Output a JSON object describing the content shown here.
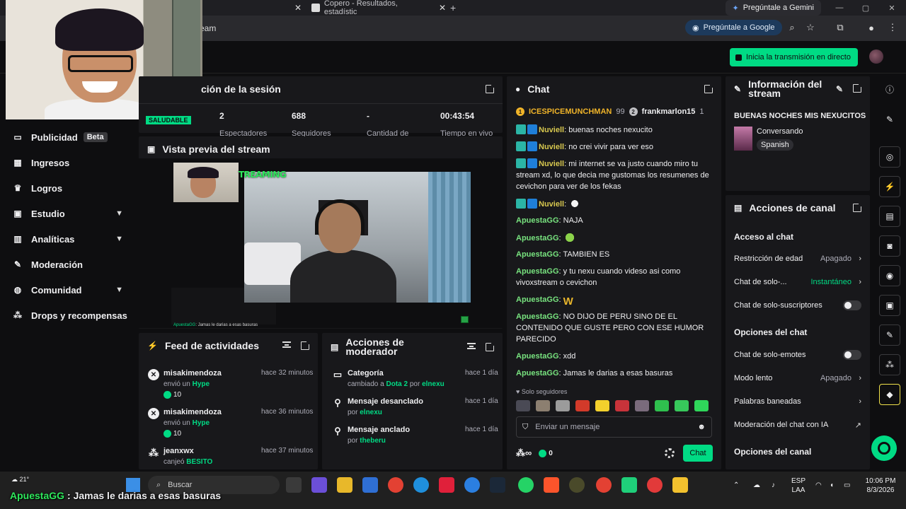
{
  "browser": {
    "tab_active_title": "Copero - Resultados, estadístic",
    "address_fragment": "eam",
    "gemini_label": "Pregúntale a Gemini",
    "ask_google_label": "Pregúntale a Google"
  },
  "appbar": {
    "go_live_label": "Inicia la transmisión en directo"
  },
  "sidebar": {
    "items": [
      {
        "label": "Publicidad",
        "badge": "Beta",
        "icon": "ad-icon"
      },
      {
        "label": "Ingresos",
        "icon": "revenue-icon"
      },
      {
        "label": "Logros",
        "icon": "trophy-icon"
      },
      {
        "label": "Estudio",
        "icon": "studio-icon",
        "expandable": true
      },
      {
        "label": "Analíticas",
        "icon": "analytics-icon",
        "expandable": true
      },
      {
        "label": "Moderación",
        "icon": "wrench-icon"
      },
      {
        "label": "Comunidad",
        "icon": "community-icon",
        "expandable": true
      },
      {
        "label": "Drops y recompensas",
        "icon": "drops-icon"
      }
    ]
  },
  "session": {
    "title": "ción de la sesión",
    "health_badge": "SALUDABLE",
    "stats": [
      {
        "value": "2",
        "label": "Espectadores"
      },
      {
        "value": "688",
        "label": "Seguidores"
      },
      {
        "value": "-",
        "label": "Cantidad de"
      },
      {
        "value": "00:43:54",
        "label": "Tiempo en vivo"
      }
    ]
  },
  "preview": {
    "title": "Vista previa del stream",
    "overlay_text": "TREAMING",
    "overlay_chat_user": "ApuestaGG",
    "overlay_chat_text": ": Jamas le darias a esas basuras"
  },
  "activity_feed": {
    "title": "Feed de actividades",
    "items": [
      {
        "user": "misakimendoza",
        "action": "envió un",
        "item": "Hype",
        "amount": "10",
        "time": "hace 32 minutos"
      },
      {
        "user": "misakimendoza",
        "action": "envió un",
        "item": "Hype",
        "amount": "10",
        "time": "hace 36 minutos"
      },
      {
        "user": "jeanxwx",
        "action": "canjeó",
        "item": "BESITO",
        "time": "hace 37 minutos"
      }
    ]
  },
  "mod_actions": {
    "title_line1": "Acciones de",
    "title_line2": "moderador",
    "items": [
      {
        "title": "Categoría",
        "sub_prefix": "cambiado a",
        "sub_hl": "Dota 2",
        "sub_mid": "por",
        "sub_user": "elnexu",
        "time": "hace 1 día"
      },
      {
        "title": "Mensaje desanclado",
        "sub_mid": "por",
        "sub_user": "elnexu",
        "time": "hace 1 día"
      },
      {
        "title": "Mensaje anclado",
        "sub_mid": "por",
        "sub_user": "theberu",
        "time": "hace 1 día"
      }
    ]
  },
  "chat": {
    "title": "Chat",
    "top_gifters": [
      {
        "rank": "1",
        "name": "ICESPICEMUNCHMAN",
        "count": "99"
      },
      {
        "rank": "2",
        "name": "frankmarlon15",
        "count": "1"
      }
    ],
    "messages": [
      {
        "user": "Nuviell",
        "text": "buenas noches nexucito"
      },
      {
        "user": "Nuviell",
        "text": "no crei vivir para ver eso"
      },
      {
        "user": "Nuviell",
        "text": "mi internet se va justo cuando miro tu stream xd, lo que decia me gustomas los resumenes de cevichon para ver de los fekas"
      },
      {
        "user": "Nuviell",
        "text": ""
      },
      {
        "user": "ApuestaGG",
        "text": "NAJA"
      },
      {
        "user": "ApuestaGG",
        "text": ""
      },
      {
        "user": "ApuestaGG",
        "text": "TAMBIEN ES"
      },
      {
        "user": "ApuestaGG",
        "text": "y tu nexu cuando videso asi como vivoxstream o cevichon"
      },
      {
        "user": "ApuestaGG",
        "text": ""
      },
      {
        "user": "ApuestaGG",
        "text": "NO DIJO DE PERU SINO DE EL CONTENIDO QUE GUSTE PERO CON ESE HUMOR PARECIDO"
      },
      {
        "user": "ApuestaGG",
        "text": "xdd"
      },
      {
        "user": "ApuestaGG",
        "text": "Jamas le darias a esas basuras"
      }
    ],
    "filter_label": "Solo seguidores",
    "input_placeholder": "Enviar un mensaje",
    "points": "0",
    "send_label": "Chat"
  },
  "stream_info": {
    "title_line1": "Información del",
    "title_line2": "stream",
    "stream_title": "BUENAS NOCHES MIS NEXUCITOS",
    "category": "Conversando",
    "language_tag": "Spanish"
  },
  "channel_actions": {
    "title": "Acciones de canal",
    "section1": "Acceso al chat",
    "rows1": [
      {
        "label": "Restricción de edad",
        "value": "Apagado"
      },
      {
        "label": "Chat de solo-...",
        "value": "Instantáneo"
      },
      {
        "label": "Chat de solo-suscriptores",
        "toggle": true
      }
    ],
    "section2": "Opciones del chat",
    "rows2": [
      {
        "label": "Chat de solo-emotes",
        "toggle": true
      },
      {
        "label": "Modo lento",
        "value": "Apagado"
      },
      {
        "label": "Palabras baneadas"
      },
      {
        "label": "Moderación del chat con IA"
      }
    ],
    "section3": "Opciones del canal"
  },
  "taskbar": {
    "search_label": "Buscar",
    "weather": "21°",
    "lang_line1": "ESP",
    "lang_line2": "LAA",
    "time": "10:06 PM",
    "date": "8/3/2026"
  }
}
